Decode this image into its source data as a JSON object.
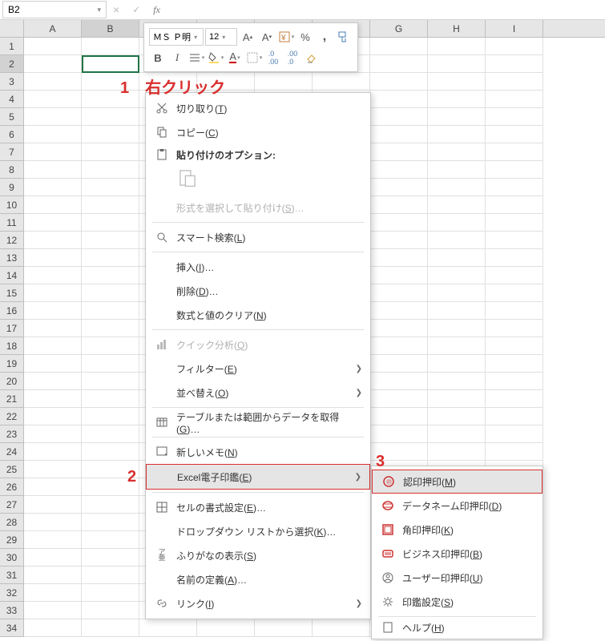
{
  "namebox": {
    "value": "B2"
  },
  "mini_toolbar": {
    "font": "ＭＳ Ｐ明",
    "size": "12",
    "bold": "B",
    "italic": "I",
    "fontcolor_letter": "A"
  },
  "annotations": {
    "a1": "1　右クリック",
    "a2": "2",
    "a3": "3"
  },
  "columns": [
    "A",
    "B",
    "C",
    "D",
    "E",
    "F",
    "G",
    "H",
    "I"
  ],
  "row_count": 34,
  "selected_cell": {
    "row": 2,
    "col": "B"
  },
  "context_menu": {
    "cut": "切り取り(T)",
    "copy": "コピー(C)",
    "paste_header": "貼り付けのオプション:",
    "paste_special": "形式を選択して貼り付け(S)…",
    "smart_lookup": "スマート検索(L)",
    "insert": "挿入(I)…",
    "delete": "削除(D)…",
    "clear": "数式と値のクリア(N)",
    "quick_analysis": "クイック分析(Q)",
    "filter": "フィルター(E)",
    "sort": "並べ替え(O)",
    "get_data": "テーブルまたは範囲からデータを取得(G)…",
    "new_note": "新しいメモ(N)",
    "excel_stamp": "Excel電子印鑑(E)",
    "format_cells": "セルの書式設定(E)…",
    "dropdown_pick": "ドロップダウン リストから選択(K)…",
    "furigana": "ふりがなの表示(S)",
    "define_name": "名前の定義(A)…",
    "link": "リンク(I)"
  },
  "submenu": {
    "approval_stamp": "認印押印(M)",
    "dataname_stamp": "データネーム印押印(D)",
    "square_stamp": "角印押印(K)",
    "business_stamp": "ビジネス印押印(B)",
    "user_stamp": "ユーザー印押印(U)",
    "stamp_settings": "印鑑設定(S)",
    "help": "ヘルプ(H)"
  }
}
